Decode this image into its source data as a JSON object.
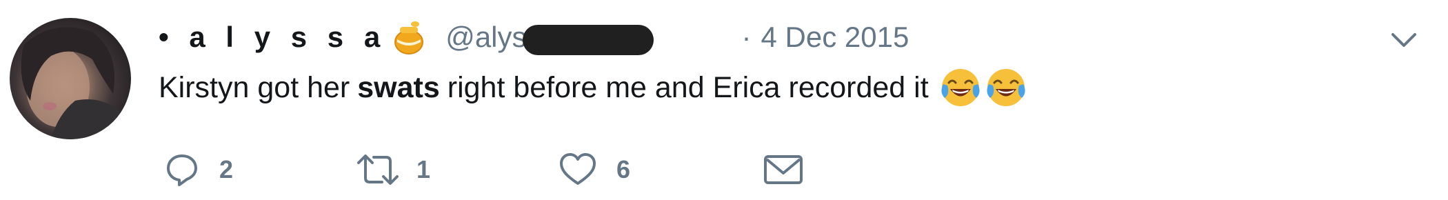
{
  "tweet": {
    "display_name": "• a l y s s a",
    "name_emoji": "honey-pot-emoji",
    "handle": "@alys",
    "separator": "·",
    "timestamp": "4 Dec 2015",
    "text": {
      "part1": "Kirstyn got her",
      "bold": "swats",
      "part2": "right before me and Erica recorded it"
    },
    "text_emojis": [
      "face-with-tears-of-joy",
      "face-with-tears-of-joy"
    ]
  },
  "actions": {
    "reply": {
      "count": "2",
      "icon": "reply-icon"
    },
    "retweet": {
      "count": "1",
      "icon": "retweet-icon"
    },
    "like": {
      "count": "6",
      "icon": "heart-icon"
    },
    "message": {
      "icon": "envelope-icon"
    }
  },
  "colors": {
    "text": "#14171a",
    "secondary": "#657786",
    "emoji_yellow": "#f7c03a"
  }
}
